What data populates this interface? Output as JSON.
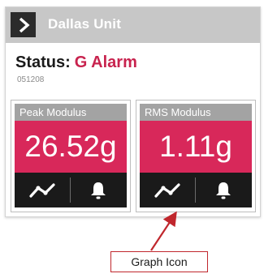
{
  "header": {
    "title": "Dallas Unit",
    "nav_icon": "chevron-right-icon"
  },
  "status": {
    "label": "Status:",
    "value": "G Alarm",
    "code": "051208"
  },
  "tiles": [
    {
      "label": "Peak Modulus",
      "value": "26.52g",
      "buttons": [
        "graph-icon",
        "bell-icon"
      ]
    },
    {
      "label": "RMS Modulus",
      "value": "1.11g",
      "buttons": [
        "graph-icon",
        "bell-icon"
      ]
    }
  ],
  "annotation": {
    "text": "Graph Icon"
  },
  "colors": {
    "header": "#c7c7c7",
    "alarm": "#c8234e",
    "tile_value_bg": "#d8285a",
    "tile_head_bg": "#a3a3a3",
    "tile_foot_bg": "#1a1a1a",
    "callout": "#c0272d"
  }
}
